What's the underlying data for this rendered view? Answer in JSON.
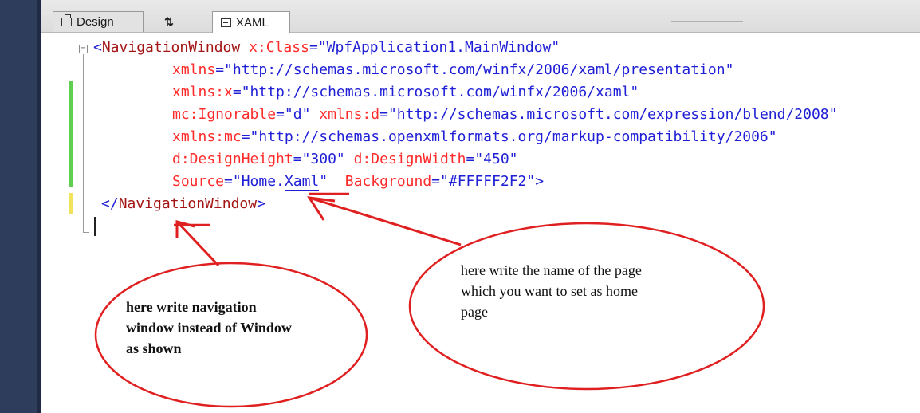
{
  "tabs": {
    "design_label": "Design",
    "swap_label": "⇅",
    "xaml_label": "XAML"
  },
  "code": {
    "line1": {
      "bracket": "<",
      "tag": "NavigationWindow",
      "attr": "x:Class",
      "eq": "=",
      "value": "\"WpfApplication1.MainWindow\""
    },
    "line2": {
      "attr": "xmlns",
      "eq": "=",
      "value": "\"http://schemas.microsoft.com/winfx/2006/xaml/presentation\""
    },
    "line3": {
      "attr": "xmlns:x",
      "eq": "=",
      "value": "\"http://schemas.microsoft.com/winfx/2006/xaml\""
    },
    "line4": {
      "attr1": "mc:Ignorable",
      "eq1": "=",
      "value1": "\"d\"",
      "attr2": "xmlns:d",
      "eq2": "=",
      "value2": "\"http://schemas.microsoft.com/expression/blend/2008\""
    },
    "line5": {
      "attr": "xmlns:mc",
      "eq": "=",
      "value": "\"http://schemas.openxmlformats.org/markup-compatibility/2006\""
    },
    "line6": {
      "attr1": "d:DesignHeight",
      "eq1": "=",
      "value1": "\"300\"",
      "attr2": "d:DesignWidth",
      "eq2": "=",
      "value2": "\"450\""
    },
    "line7": {
      "attr1": "Source",
      "eq1": "=",
      "value1a": "\"Home.",
      "value1b": "Xaml",
      "value1c": "\"",
      "attr2": "Background",
      "eq2": "=",
      "value2": "\"#FFFFF2F2\"",
      "close": ">"
    },
    "line8": {
      "open": "</",
      "tag": "NavigationWindow",
      "close": ">"
    }
  },
  "annotations": {
    "left_note": [
      "here write navigation",
      "window instead of Window",
      "as shown"
    ],
    "right_note": [
      "here write the name of the page",
      "which you want to set as home",
      "page"
    ]
  },
  "colors": {
    "sidebar": "#2f3d5c",
    "keyword_blue": "#1f1fd6",
    "tag_maroon": "#a31515",
    "attribute_red": "#ff2a2a",
    "annotation_red": "#e02020",
    "change_green": "#5fcf4f",
    "change_yellow": "#f3e35a"
  }
}
